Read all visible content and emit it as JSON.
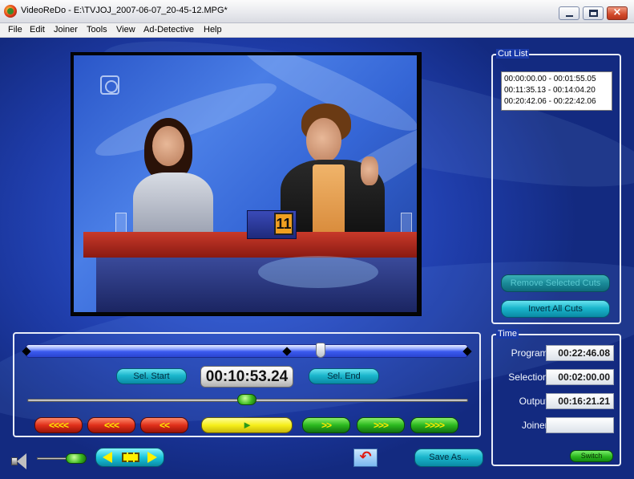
{
  "window": {
    "title": "VideoReDo - E:\\TVJOJ_2007-06-07_20-45-12.MPG*",
    "close_glyph": "×"
  },
  "menu": [
    "File",
    "Edit",
    "Joiner",
    "Tools",
    "View",
    "Ad-Detective",
    "Help"
  ],
  "video": {
    "podium_number": "11"
  },
  "cut_list": {
    "title": "Cut List",
    "items": [
      "00:00:00.00 - 00:01:55.05",
      "00:11:35.13 - 00:14:04.20",
      "00:20:42.06 - 00:22:42.06"
    ],
    "remove_label": "Remove Selected Cuts",
    "invert_label": "Invert All Cuts"
  },
  "time_panel": {
    "title": "Time",
    "program_label": "Program:",
    "program_value": "00:22:46.08",
    "selection_label": "Selection:",
    "selection_value": "00:02:00.00",
    "output_label": "Output:",
    "output_value": "00:16:21.21",
    "joiner_label": "Joiner:",
    "joiner_value": "",
    "switch_label": "Switch"
  },
  "navigation": {
    "sel_start_label": "Sel. Start",
    "sel_end_label": "Sel. End",
    "timecode": "00:10:53.24",
    "playhead_fraction": 0.48,
    "back_buttons": [
      "<<<<",
      "<<<",
      "<<"
    ],
    "play_glyph": "►",
    "forward_buttons": [
      ">>",
      ">>>",
      ">>>>"
    ]
  },
  "bottom": {
    "volume_fraction": 0.8,
    "undo_glyph": "↶",
    "save_label": "Save As..."
  },
  "colors": {
    "background": "#1b3a9c",
    "teal_button": "#1ab6cc",
    "red_button": "#e0301a",
    "green_button": "#2ab81e",
    "yellow_button": "#f6ee1a"
  }
}
